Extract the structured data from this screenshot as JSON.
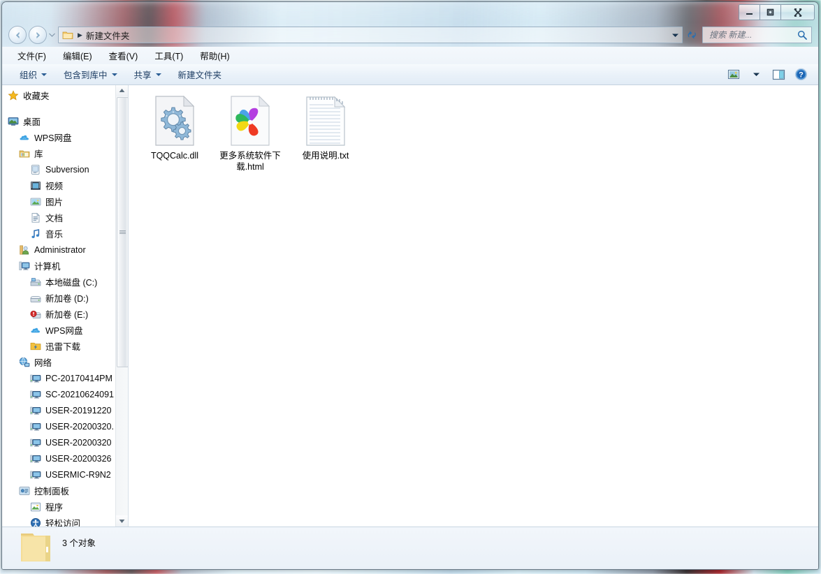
{
  "window": {
    "titlebar_buttons": [
      {
        "name": "minimize",
        "label": "最小化"
      },
      {
        "name": "maximize",
        "label": "最大化"
      },
      {
        "name": "close",
        "label": "关闭"
      }
    ]
  },
  "address": {
    "crumb": "新建文件夹",
    "folder_icon": "folder-icon",
    "separator": "▶",
    "history_dropdown_icon": "chevron-down-icon",
    "dropdown_icon": "chevron-down-icon",
    "refresh_icon": "refresh-icon",
    "back_icon": "back-arrow-icon",
    "forward_icon": "forward-arrow-icon"
  },
  "search": {
    "placeholder": "搜索 新建...",
    "value": "",
    "icon": "search-icon"
  },
  "menubar": {
    "items": [
      {
        "label": "文件(F)",
        "name": "menu-file"
      },
      {
        "label": "编辑(E)",
        "name": "menu-edit"
      },
      {
        "label": "查看(V)",
        "name": "menu-view"
      },
      {
        "label": "工具(T)",
        "name": "menu-tools"
      },
      {
        "label": "帮助(H)",
        "name": "menu-help"
      }
    ]
  },
  "commandbar": {
    "buttons": [
      {
        "label": "组织",
        "name": "organize-button",
        "caret": true
      },
      {
        "label": "包含到库中",
        "name": "include-in-library-button",
        "caret": true
      },
      {
        "label": "共享",
        "name": "share-button",
        "caret": true
      },
      {
        "label": "新建文件夹",
        "name": "new-folder-button",
        "caret": false
      }
    ],
    "right_icons": [
      {
        "name": "view-options-icon"
      },
      {
        "name": "view-dropdown-caret-icon"
      },
      {
        "name": "preview-pane-icon"
      },
      {
        "name": "help-icon"
      }
    ]
  },
  "navpane": {
    "items": [
      {
        "label": "收藏夹",
        "icon": "star-icon",
        "indent": 1,
        "name": "nav-favorites"
      },
      {
        "label": "",
        "icon": "",
        "indent": 0,
        "gap": true,
        "name": "nav-gap"
      },
      {
        "label": "桌面",
        "icon": "desktop-icon",
        "indent": 1,
        "name": "nav-desktop"
      },
      {
        "label": "WPS网盘",
        "icon": "cloud-icon",
        "indent": 2,
        "name": "nav-wps-cloud"
      },
      {
        "label": "库",
        "icon": "library-icon",
        "indent": 2,
        "name": "nav-libraries"
      },
      {
        "label": "Subversion",
        "icon": "subversion-icon",
        "indent": 3,
        "name": "nav-subversion"
      },
      {
        "label": "视频",
        "icon": "video-icon",
        "indent": 3,
        "name": "nav-videos"
      },
      {
        "label": "图片",
        "icon": "pictures-icon",
        "indent": 3,
        "name": "nav-pictures"
      },
      {
        "label": "文档",
        "icon": "documents-icon",
        "indent": 3,
        "name": "nav-documents"
      },
      {
        "label": "音乐",
        "icon": "music-icon",
        "indent": 3,
        "name": "nav-music"
      },
      {
        "label": "Administrator",
        "icon": "user-icon",
        "indent": 2,
        "name": "nav-administrator"
      },
      {
        "label": "计算机",
        "icon": "computer-icon",
        "indent": 2,
        "name": "nav-computer"
      },
      {
        "label": "本地磁盘 (C:)",
        "icon": "system-drive-icon",
        "indent": 3,
        "name": "nav-drive-c"
      },
      {
        "label": "新加卷 (D:)",
        "icon": "drive-icon",
        "indent": 3,
        "name": "nav-drive-d"
      },
      {
        "label": "新加卷 (E:)",
        "icon": "drive-full-icon",
        "indent": 3,
        "name": "nav-drive-e"
      },
      {
        "label": "WPS网盘",
        "icon": "cloud-icon",
        "indent": 3,
        "name": "nav-wps-cloud-2"
      },
      {
        "label": "迅雷下载",
        "icon": "thunder-download-icon",
        "indent": 3,
        "name": "nav-thunder-download"
      },
      {
        "label": "网络",
        "icon": "network-icon",
        "indent": 2,
        "name": "nav-network"
      },
      {
        "label": "PC-20170414PM",
        "icon": "computer-node-icon",
        "indent": 3,
        "name": "nav-pc-20170414pm"
      },
      {
        "label": "SC-20210624091",
        "icon": "computer-node-icon",
        "indent": 3,
        "name": "nav-sc-20210624091"
      },
      {
        "label": "USER-20191220",
        "icon": "computer-node-icon",
        "indent": 3,
        "name": "nav-user-20191220"
      },
      {
        "label": "USER-20200320.",
        "icon": "computer-node-icon",
        "indent": 3,
        "name": "nav-user-20200320a"
      },
      {
        "label": "USER-20200320",
        "icon": "computer-node-icon",
        "indent": 3,
        "name": "nav-user-20200320b"
      },
      {
        "label": "USER-20200326",
        "icon": "computer-node-icon",
        "indent": 3,
        "name": "nav-user-20200326"
      },
      {
        "label": "USERMIC-R9N2",
        "icon": "computer-node-icon",
        "indent": 3,
        "name": "nav-usermic-r9n2"
      },
      {
        "label": "控制面板",
        "icon": "control-panel-icon",
        "indent": 2,
        "name": "nav-control-panel"
      },
      {
        "label": "程序",
        "icon": "programs-icon",
        "indent": 3,
        "name": "nav-programs"
      },
      {
        "label": "轻松访问",
        "icon": "ease-of-access-icon",
        "indent": 3,
        "name": "nav-ease-of-access"
      }
    ],
    "scrollbar": {
      "up_icon": "scroll-up-icon",
      "down_icon": "scroll-down-icon"
    }
  },
  "files": [
    {
      "name": "TQQCalc.dll",
      "icon": "dll-gear-file-icon"
    },
    {
      "name": "更多系统软件下载.html",
      "icon": "html-pinwheel-file-icon"
    },
    {
      "name": "使用说明.txt",
      "icon": "txt-file-icon"
    }
  ],
  "statusbar": {
    "text": "3 个对象",
    "icon": "folder-large-icon"
  }
}
